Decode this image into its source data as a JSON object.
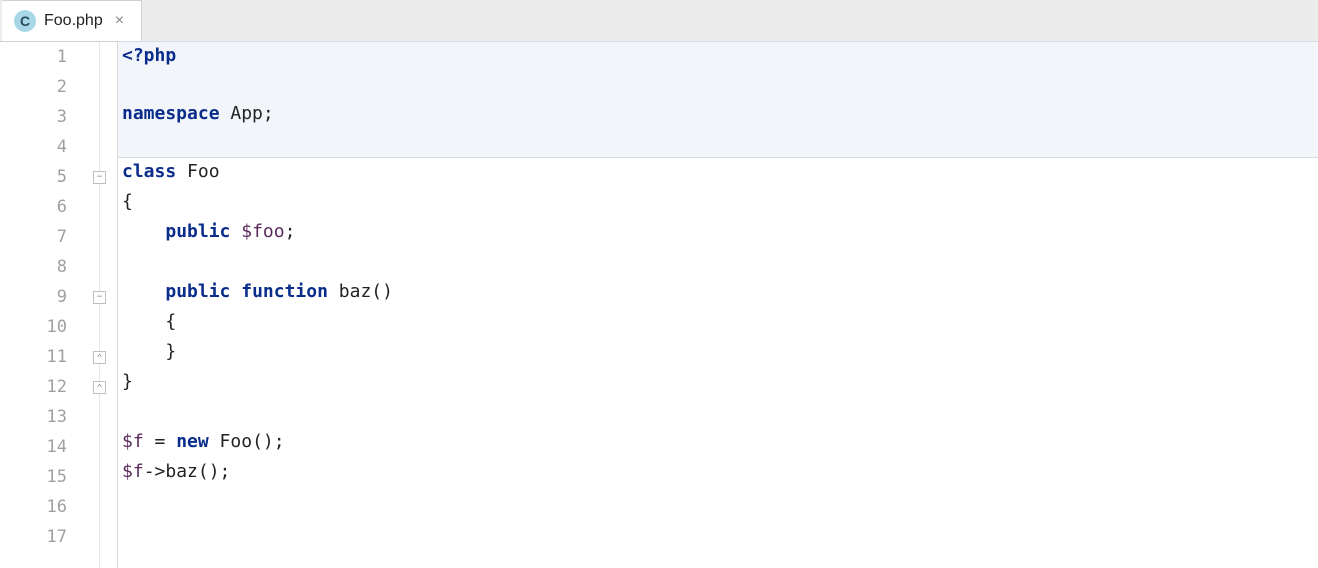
{
  "tab": {
    "icon_letter": "C",
    "filename": "Foo.php"
  },
  "editor": {
    "lines": [
      {
        "num": "1",
        "fold": null,
        "hl": true,
        "tokens": [
          {
            "t": "<?php",
            "c": "tag"
          }
        ]
      },
      {
        "num": "2",
        "fold": null,
        "hl": true,
        "tokens": []
      },
      {
        "num": "3",
        "fold": null,
        "hl": true,
        "tokens": [
          {
            "t": "namespace",
            "c": "kw"
          },
          {
            "t": " App;",
            "c": "plain"
          }
        ]
      },
      {
        "num": "4",
        "fold": null,
        "hl": true,
        "tokens": []
      },
      {
        "num": "5",
        "fold": "collapse",
        "hl": false,
        "tokens": [
          {
            "t": "class",
            "c": "kw"
          },
          {
            "t": " Foo",
            "c": "plain"
          }
        ]
      },
      {
        "num": "6",
        "fold": null,
        "hl": false,
        "tokens": [
          {
            "t": "{",
            "c": "punct"
          }
        ]
      },
      {
        "num": "7",
        "fold": null,
        "hl": false,
        "tokens": [
          {
            "t": "    ",
            "c": "plain"
          },
          {
            "t": "public",
            "c": "kw"
          },
          {
            "t": " ",
            "c": "plain"
          },
          {
            "t": "$foo",
            "c": "var"
          },
          {
            "t": ";",
            "c": "punct"
          }
        ]
      },
      {
        "num": "8",
        "fold": null,
        "hl": false,
        "tokens": []
      },
      {
        "num": "9",
        "fold": "collapse",
        "hl": false,
        "tokens": [
          {
            "t": "    ",
            "c": "plain"
          },
          {
            "t": "public",
            "c": "kw"
          },
          {
            "t": " ",
            "c": "plain"
          },
          {
            "t": "function",
            "c": "kw"
          },
          {
            "t": " baz()",
            "c": "fn"
          }
        ]
      },
      {
        "num": "10",
        "fold": null,
        "hl": false,
        "tokens": [
          {
            "t": "    {",
            "c": "punct"
          }
        ]
      },
      {
        "num": "11",
        "fold": "end",
        "hl": false,
        "tokens": [
          {
            "t": "    }",
            "c": "punct"
          }
        ]
      },
      {
        "num": "12",
        "fold": "end",
        "hl": false,
        "tokens": [
          {
            "t": "}",
            "c": "punct"
          }
        ]
      },
      {
        "num": "13",
        "fold": null,
        "hl": false,
        "tokens": []
      },
      {
        "num": "14",
        "fold": null,
        "hl": false,
        "tokens": [
          {
            "t": "$f",
            "c": "var"
          },
          {
            "t": " = ",
            "c": "plain"
          },
          {
            "t": "new",
            "c": "kw"
          },
          {
            "t": " Foo();",
            "c": "plain"
          }
        ]
      },
      {
        "num": "15",
        "fold": null,
        "hl": false,
        "tokens": [
          {
            "t": "$f",
            "c": "var"
          },
          {
            "t": "->baz();",
            "c": "plain"
          }
        ]
      },
      {
        "num": "16",
        "fold": null,
        "hl": false,
        "tokens": []
      },
      {
        "num": "17",
        "fold": null,
        "hl": false,
        "tokens": []
      }
    ]
  }
}
